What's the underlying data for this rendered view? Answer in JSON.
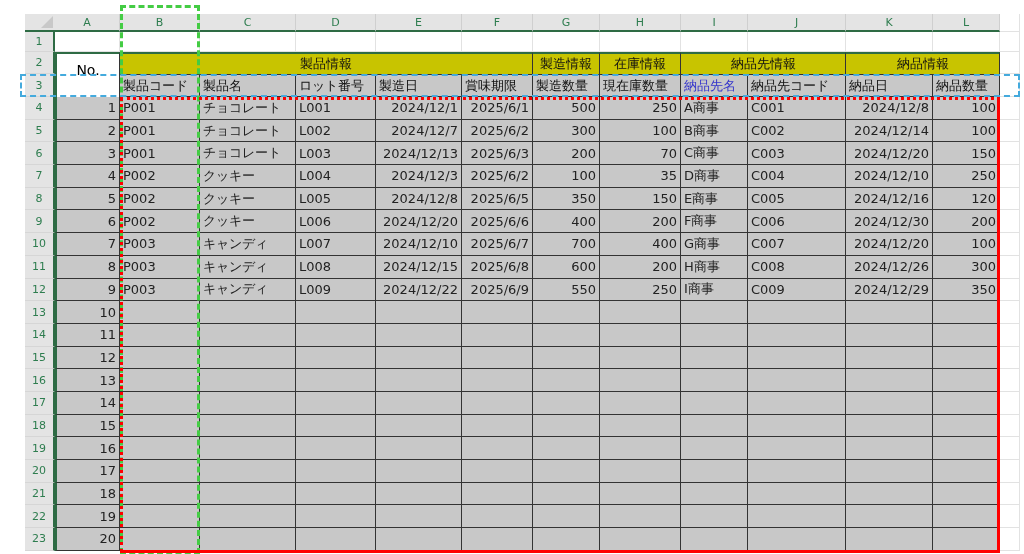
{
  "column_headers": [
    "A",
    "B",
    "C",
    "D",
    "E",
    "F",
    "G",
    "H",
    "I",
    "J",
    "K",
    "L"
  ],
  "row_numbers": [
    "1",
    "2",
    "3",
    "4",
    "5",
    "6",
    "7",
    "8",
    "9",
    "10",
    "11",
    "12",
    "13",
    "14",
    "15",
    "16",
    "17",
    "18",
    "19",
    "20",
    "21",
    "22",
    "23"
  ],
  "no_header": "No.",
  "groups": [
    {
      "label": "製品情報",
      "fields": [
        {
          "label": "製品コード",
          "kind": "text"
        },
        {
          "label": "製品名",
          "kind": "text"
        },
        {
          "label": "ロット番号",
          "kind": "text"
        },
        {
          "label": "製造日",
          "kind": "number"
        },
        {
          "label": "賞味期限",
          "kind": "number"
        }
      ]
    },
    {
      "label": "製造情報",
      "fields": [
        {
          "label": "製造数量",
          "kind": "number"
        }
      ]
    },
    {
      "label": "在庫情報",
      "fields": [
        {
          "label": "現在庫数量",
          "kind": "number"
        }
      ]
    },
    {
      "label": "納品先情報",
      "fields": [
        {
          "label": "納品先名",
          "kind": "text",
          "color": "#3333cc"
        },
        {
          "label": "納品先コード",
          "kind": "text"
        }
      ]
    },
    {
      "label": "納品情報",
      "fields": [
        {
          "label": "納品日",
          "kind": "number"
        },
        {
          "label": "納品数量",
          "kind": "number"
        }
      ]
    }
  ],
  "rows": [
    {
      "no": "1",
      "cells": [
        "P001",
        "チョコレート",
        "L001",
        "2024/12/1",
        "2025/6/1",
        "500",
        "250",
        "A商事",
        "C001",
        "2024/12/8",
        "100"
      ]
    },
    {
      "no": "2",
      "cells": [
        "P001",
        "チョコレート",
        "L002",
        "2024/12/7",
        "2025/6/2",
        "300",
        "100",
        "B商事",
        "C002",
        "2024/12/14",
        "100"
      ]
    },
    {
      "no": "3",
      "cells": [
        "P001",
        "チョコレート",
        "L003",
        "2024/12/13",
        "2025/6/3",
        "200",
        "70",
        "C商事",
        "C003",
        "2024/12/20",
        "150"
      ]
    },
    {
      "no": "4",
      "cells": [
        "P002",
        "クッキー",
        "L004",
        "2024/12/3",
        "2025/6/2",
        "100",
        "35",
        "D商事",
        "C004",
        "2024/12/10",
        "250"
      ]
    },
    {
      "no": "5",
      "cells": [
        "P002",
        "クッキー",
        "L005",
        "2024/12/8",
        "2025/6/5",
        "350",
        "150",
        "E商事",
        "C005",
        "2024/12/16",
        "120"
      ]
    },
    {
      "no": "6",
      "cells": [
        "P002",
        "クッキー",
        "L006",
        "2024/12/20",
        "2025/6/6",
        "400",
        "200",
        "F商事",
        "C006",
        "2024/12/30",
        "200"
      ]
    },
    {
      "no": "7",
      "cells": [
        "P003",
        "キャンディ",
        "L007",
        "2024/12/10",
        "2025/6/7",
        "700",
        "400",
        "G商事",
        "C007",
        "2024/12/20",
        "100"
      ]
    },
    {
      "no": "8",
      "cells": [
        "P003",
        "キャンディ",
        "L008",
        "2024/12/15",
        "2025/6/8",
        "600",
        "200",
        "H商事",
        "C008",
        "2024/12/26",
        "300"
      ]
    },
    {
      "no": "9",
      "cells": [
        "P003",
        "キャンディ",
        "L009",
        "2024/12/22",
        "2025/6/9",
        "550",
        "250",
        "I商事",
        "C009",
        "2024/12/29",
        "350"
      ]
    },
    {
      "no": "10",
      "cells": []
    },
    {
      "no": "11",
      "cells": []
    },
    {
      "no": "12",
      "cells": []
    },
    {
      "no": "13",
      "cells": []
    },
    {
      "no": "14",
      "cells": []
    },
    {
      "no": "15",
      "cells": []
    },
    {
      "no": "16",
      "cells": []
    },
    {
      "no": "17",
      "cells": []
    },
    {
      "no": "18",
      "cells": []
    },
    {
      "no": "19",
      "cells": []
    },
    {
      "no": "20",
      "cells": []
    }
  ],
  "highlights": [
    {
      "kind": "column",
      "color": "#44cc44"
    },
    {
      "kind": "row",
      "color": "#44aadd"
    },
    {
      "kind": "range",
      "color": "#ff0000"
    }
  ]
}
